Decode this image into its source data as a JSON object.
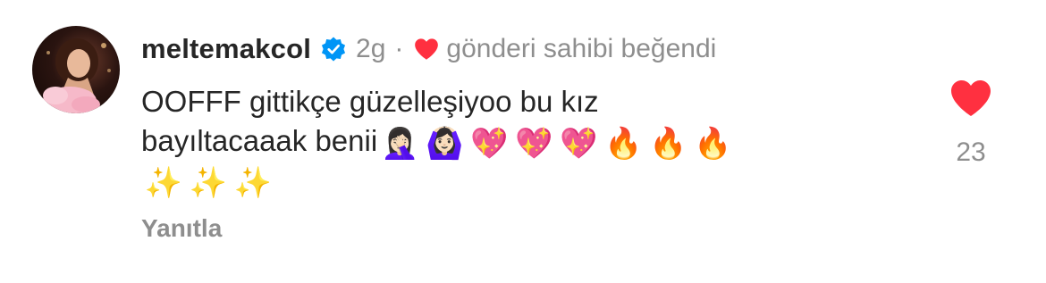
{
  "comment": {
    "username": "meltemakcol",
    "time": "2g",
    "separator": "·",
    "liked_by_author_text": "gönderi sahibi beğendi",
    "text_line1": "OOFFF gittikçe güzelleşiyoo bu kız",
    "text_line2_prefix": "bayıltacaaak benii",
    "emojis_line2": [
      "🤦🏻‍♀️",
      "🙆🏻‍♀️",
      "💖",
      "💖",
      "💖",
      "🔥",
      "🔥",
      "🔥"
    ],
    "emojis_line3": [
      "✨",
      "✨",
      "✨"
    ],
    "reply_label": "Yanıtla",
    "like_count": "23"
  },
  "icons": {
    "verified": "verified-badge-icon",
    "liked": "heart-icon",
    "like_button": "heart-filled-icon"
  },
  "colors": {
    "verified_blue": "#0095f6",
    "heart_red": "#ff3040",
    "secondary_text": "#8e8e8e",
    "primary_text": "#262626"
  }
}
